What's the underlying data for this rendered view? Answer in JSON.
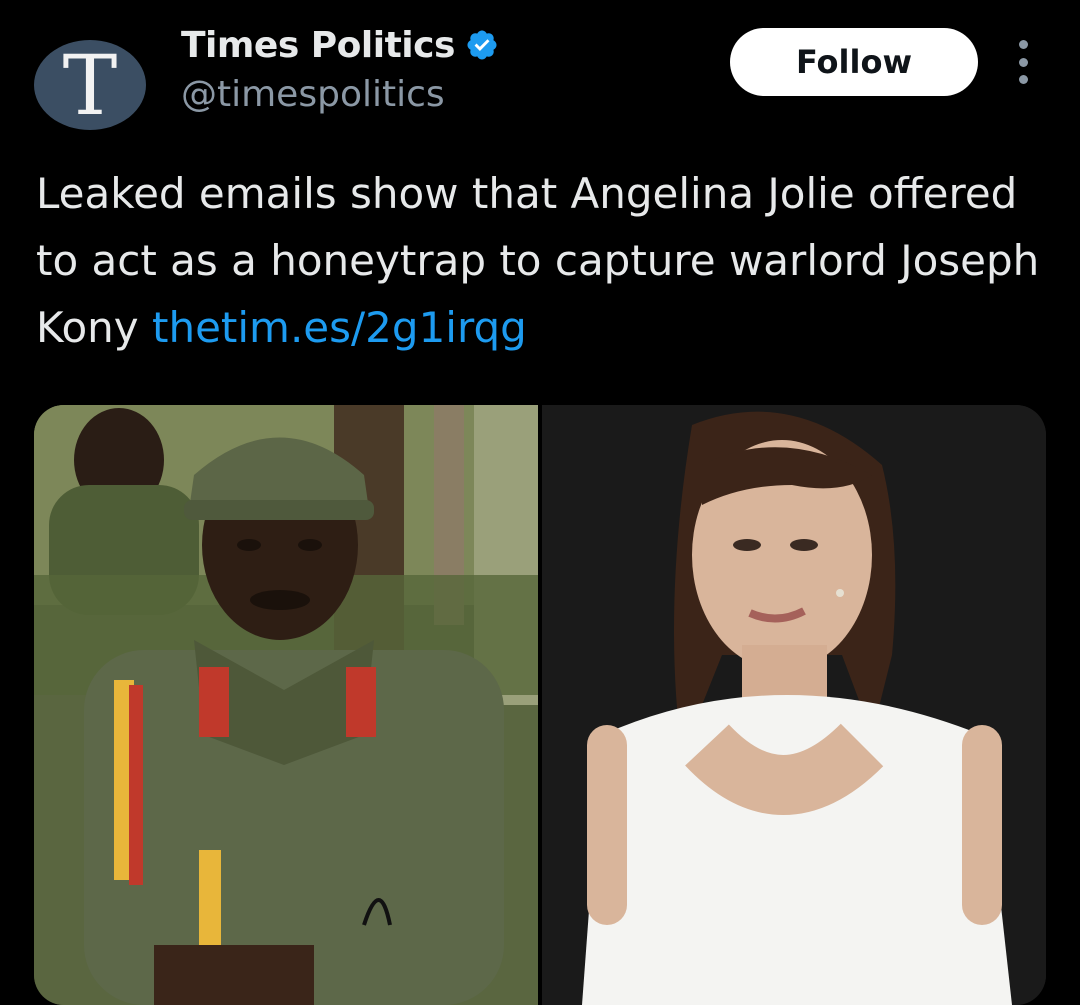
{
  "tweet": {
    "avatar_letter": "T",
    "display_name": "Times Politics",
    "handle": "@timespolitics",
    "follow_label": "Follow",
    "text_parts": [
      "Leaked emails show that Angelina Jolie offered to act as a honeytrap to capture warlord Joseph Kony "
    ],
    "link_text": "thetim.es/2g1irqg"
  },
  "media": {
    "left_image_icon": "photo-soldier-in-uniform",
    "right_image_icon": "photo-woman-in-white-top"
  },
  "colors": {
    "background": "#000000",
    "text": "#e7e9ea",
    "secondary_text": "#8b98a5",
    "link": "#1d9bf0",
    "verified_badge": "#1d9bf0",
    "avatar_bg": "#3b4e63",
    "follow_button_bg": "#ffffff",
    "follow_button_text": "#0f1419"
  },
  "icons": {
    "verified": "verified-badge-icon",
    "more": "more-options-icon"
  }
}
